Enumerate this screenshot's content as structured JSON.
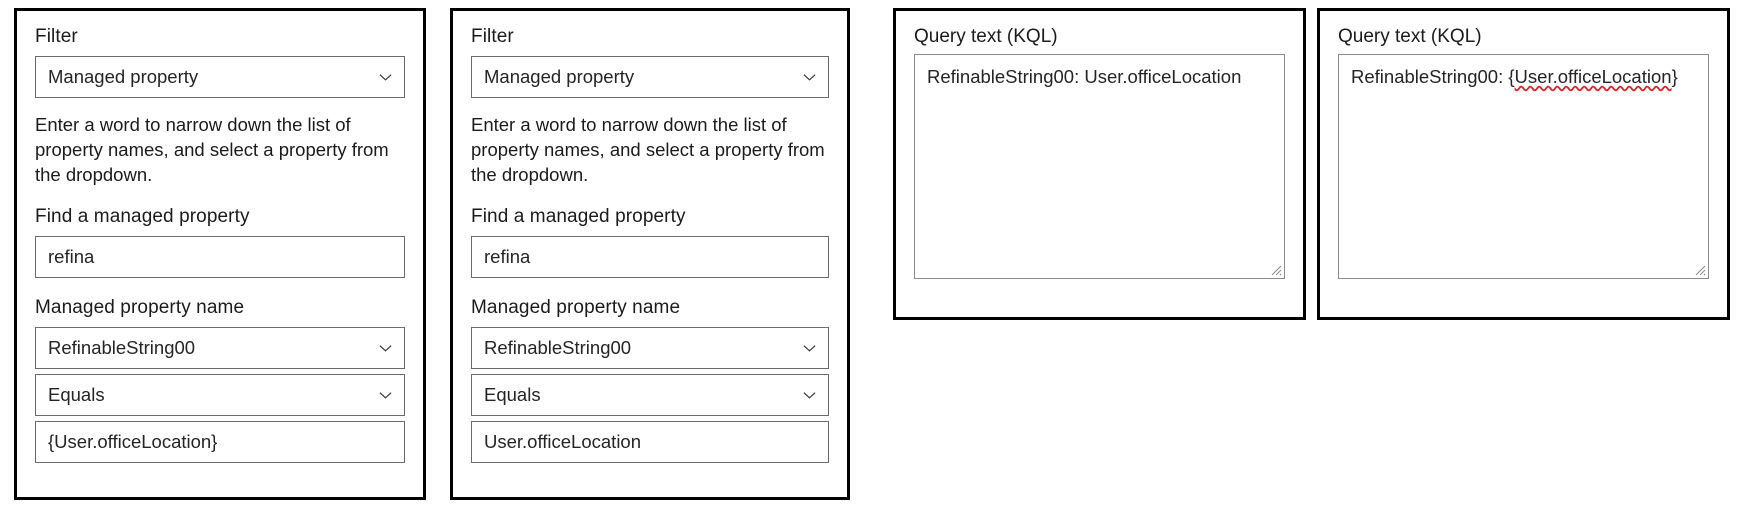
{
  "panels": {
    "filter_a": {
      "filter_label": "Filter",
      "filter_select_value": "Managed property",
      "help_text": "Enter a word to narrow down the list of property names, and select a property from the dropdown.",
      "find_label": "Find a managed property",
      "find_value": "refina",
      "name_label": "Managed property name",
      "name_select_value": "RefinableString00",
      "operator_select_value": "Equals",
      "operand_value": "{User.officeLocation}"
    },
    "filter_b": {
      "filter_label": "Filter",
      "filter_select_value": "Managed property",
      "help_text": "Enter a word to narrow down the list of property names, and select a property from the dropdown.",
      "find_label": "Find a managed property",
      "find_value": "refina",
      "name_label": "Managed property name",
      "name_select_value": "RefinableString00",
      "operator_select_value": "Equals",
      "operand_value": "User.officeLocation"
    },
    "kql_a": {
      "label": "Query text (KQL)",
      "prefix": "RefinableString00: ",
      "token": "User.officeLocation",
      "token_has_error": false,
      "full_text": "RefinableString00: User.officeLocation"
    },
    "kql_b": {
      "label": "Query text (KQL)",
      "prefix": "RefinableString00: ",
      "open_brace": "{",
      "token": "User.officeLocation",
      "close_brace": "}",
      "token_has_error": true,
      "full_text": "RefinableString00: {User.officeLocation}"
    }
  },
  "colors": {
    "panel_border": "#000000",
    "control_border": "#6b6b6b",
    "text": "#1b1b1b",
    "value_text": "#252525",
    "spellcheck_underline": "#e11d26",
    "background": "#ffffff"
  },
  "icons": {
    "chevron_down": "chevron-down-icon",
    "resize_grip": "resize-grip-icon"
  }
}
